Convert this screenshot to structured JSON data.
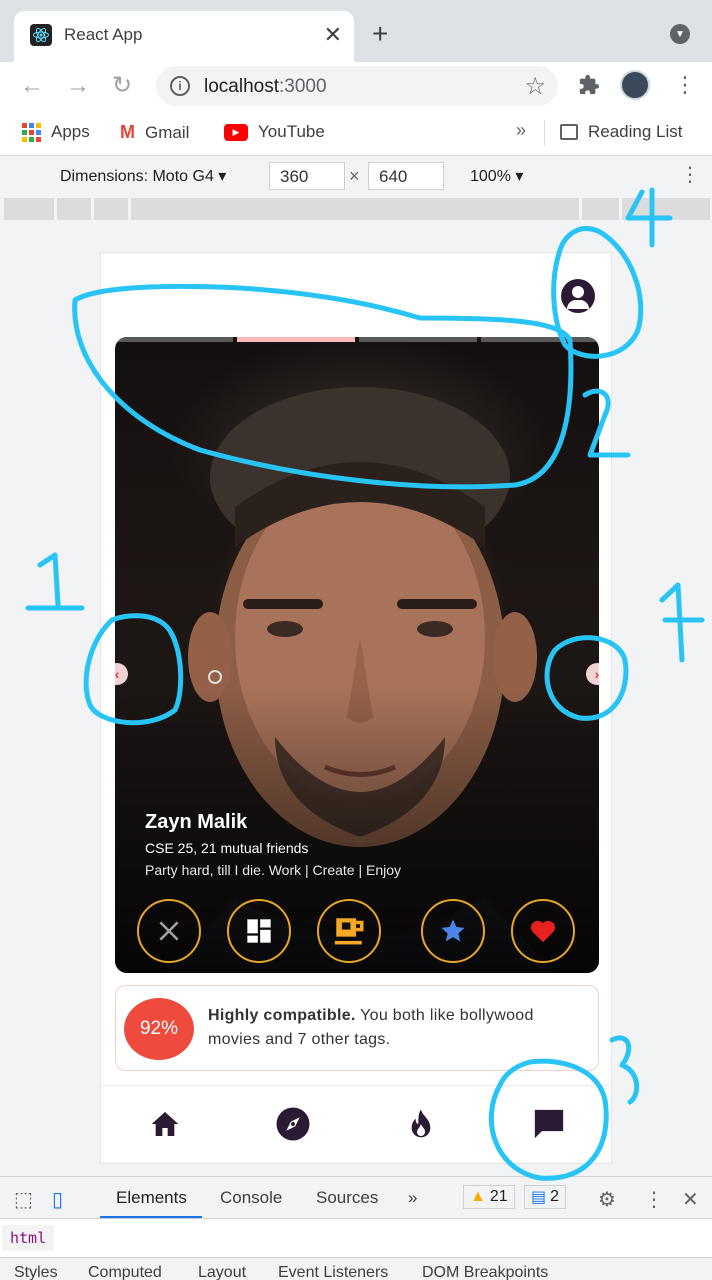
{
  "browser": {
    "tab_title": "React App",
    "url_host": "localhost",
    "url_port": ":3000",
    "bookmarks": [
      {
        "label": "Apps"
      },
      {
        "label": "Gmail"
      },
      {
        "label": "YouTube"
      }
    ],
    "bookmarks_more": "»",
    "reading_list": "Reading List"
  },
  "device_toolbar": {
    "dimensions_label": "Dimensions: Moto G4",
    "width": "360",
    "height": "640",
    "times": "×",
    "zoom": "100%"
  },
  "app": {
    "card": {
      "name": "Zayn Malik",
      "subtitle": "CSE 25, 21 mutual friends",
      "bio": "Party hard, till I die. Work | Create | Enjoy",
      "photo_count": 4,
      "active_photo": 1
    },
    "actions": [
      {
        "name": "dislike",
        "icon": "close-icon",
        "color": "#9e9e9e"
      },
      {
        "name": "gallery",
        "icon": "grid-icon",
        "color": "#ffffff"
      },
      {
        "name": "coffee",
        "icon": "coffee-icon",
        "color": "#f4a826"
      },
      {
        "name": "superlike",
        "icon": "star-icon",
        "color": "#4a86e8"
      },
      {
        "name": "like",
        "icon": "heart-icon",
        "color": "#e8211e"
      }
    ],
    "compatibility": {
      "percent": "92%",
      "headline": "Highly compatible.",
      "detail": "You both like bollywood movies and 7 other tags."
    },
    "bottom_nav": [
      {
        "name": "home",
        "icon": "home-icon"
      },
      {
        "name": "explore",
        "icon": "compass-icon"
      },
      {
        "name": "matches",
        "icon": "flame-icon"
      },
      {
        "name": "chat",
        "icon": "chat-icon"
      }
    ],
    "brand_color": "#2b1a33",
    "accent_color": "#ee4b3e"
  },
  "devtools": {
    "tabs": [
      "Elements",
      "Console",
      "Sources"
    ],
    "more": "»",
    "warnings": "21",
    "messages": "2",
    "breadcrumb": "html",
    "subtabs": [
      "Styles",
      "Computed",
      "Layout",
      "Event Listeners",
      "DOM Breakpoints"
    ]
  },
  "annotations": [
    {
      "label": "1",
      "target": "previous photo arrow"
    },
    {
      "label": "1",
      "target": "next photo arrow"
    },
    {
      "label": "2",
      "target": "photo progress bar"
    },
    {
      "label": "3",
      "target": "chat nav button"
    },
    {
      "label": "4",
      "target": "profile button"
    }
  ],
  "annotation_color": "#29c4f6"
}
